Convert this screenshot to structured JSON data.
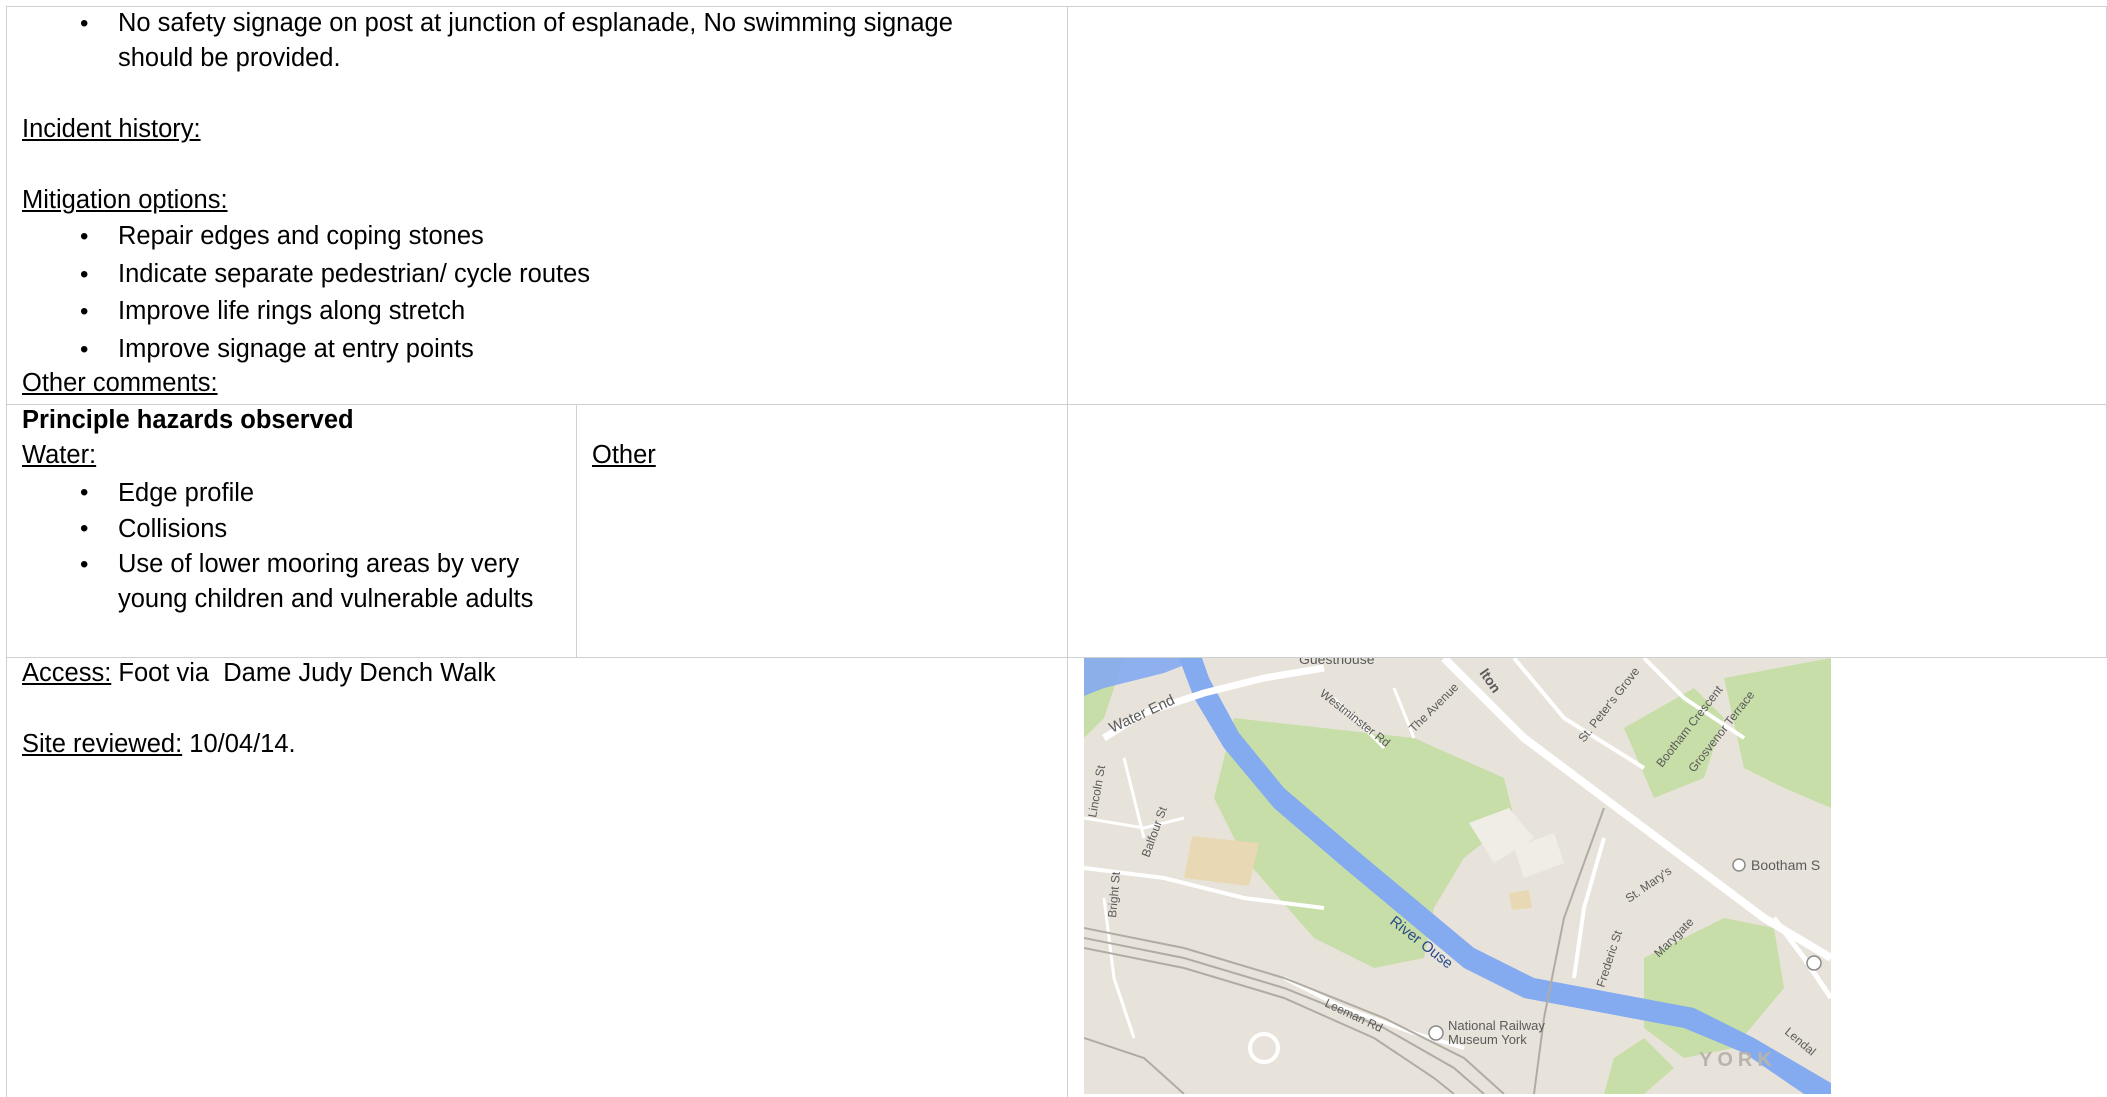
{
  "row1": {
    "continued_bullet": [
      "No safety signage on post at junction of esplanade, No swimming signage",
      "should be provided."
    ],
    "incident_history_label": "Incident history:",
    "mitigation_label": "Mitigation options:",
    "mitigation_items": [
      "Repair edges and coping stones",
      "Indicate separate pedestrian/ cycle routes",
      "Improve life rings along stretch",
      "Improve signage at entry points"
    ],
    "other_comments_label": "Other comments:"
  },
  "row2": {
    "heading": "Principle hazards observed",
    "water_label": "Water:",
    "water_items": [
      "Edge profile",
      "Collisions",
      "Use of lower mooring areas by very",
      "young children and vulnerable adults"
    ],
    "other_label": "Other"
  },
  "row3": {
    "access_label": "Access:",
    "access_value": " Foot via  Dame Judy Dench Walk",
    "reviewed_label": "Site reviewed:",
    "reviewed_value": " 10/04/14."
  },
  "map": {
    "labels": {
      "guesthouse": "Guesthouse",
      "water_end": "Water End",
      "westminster": "Westminster Rd",
      "avenue": "The Avenue",
      "st_peters": "St. Peter's Grove",
      "bootham_crescent": "Bootham Crescent",
      "grosvenor": "Grosvenor Terrace",
      "lincoln": "Lincoln St",
      "balfour": "Balfour St",
      "bootham_s": "Bootham S",
      "st_marys": "St. Mary's",
      "bright": "Bright St",
      "river": "River Ouse",
      "marygate": "Marygate",
      "frederic": "Frederic St",
      "leeman": "Leeman Rd",
      "railway_museum_1": "National Railway",
      "railway_museum_2": "Museum York",
      "lendal": "Lendal",
      "york": "YORK",
      "top_clipped": "lton"
    },
    "colors": {
      "land": "#e8e3da",
      "green": "#c8dea8",
      "river": "#84aaf0",
      "road": "#ffffff",
      "sand": "#e8d8b4"
    }
  }
}
